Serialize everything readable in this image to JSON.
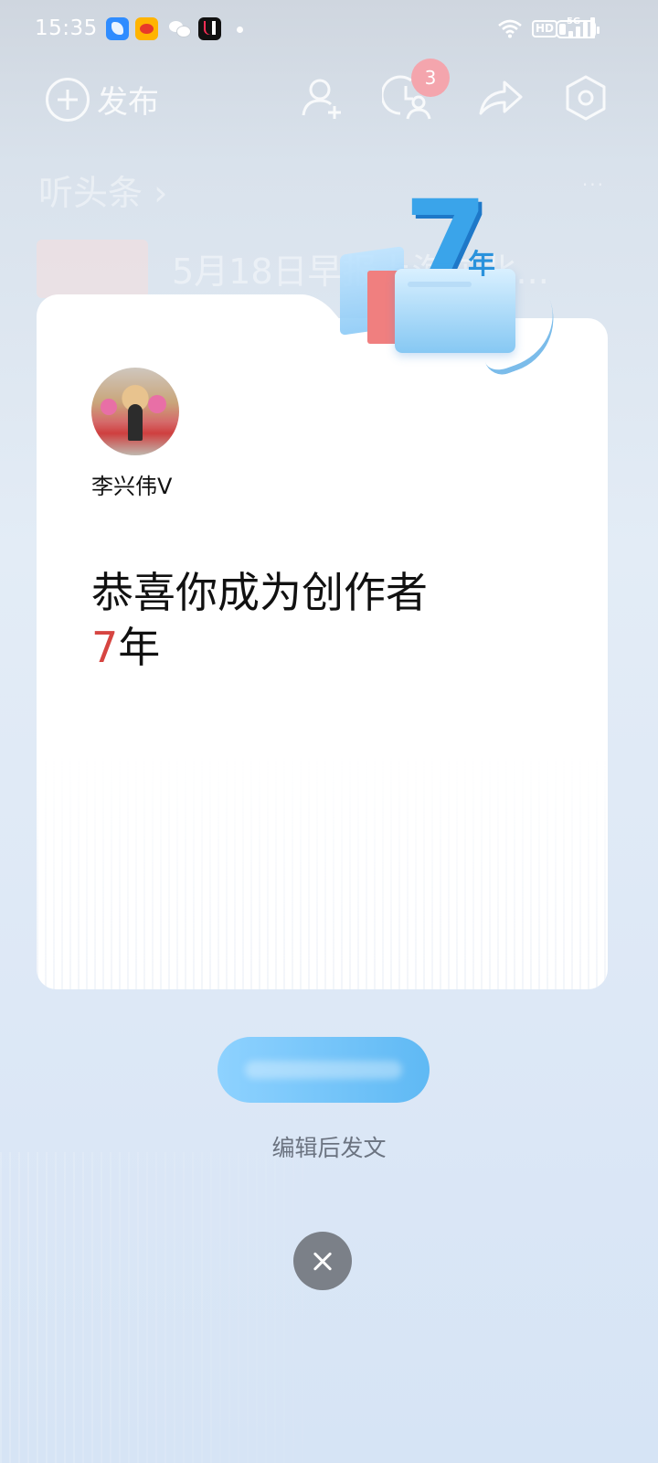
{
  "status_bar": {
    "time": "15:35",
    "network": "5G",
    "hd": "HD",
    "battery_level": 0.2
  },
  "header": {
    "publish_label": "发布",
    "notification_count": "3",
    "icons": [
      "add-friend-icon",
      "visitors-icon",
      "share-icon",
      "settings-icon"
    ]
  },
  "feed": {
    "section_title": "听头条 ›",
    "more": "···",
    "first_item_text": "5月18日早报上海车北..."
  },
  "card": {
    "username": "李兴伟V",
    "congrats_line": "恭喜你成为创作者",
    "years_number": "7",
    "years_unit": "年",
    "emblem_number": "7",
    "emblem_unit": "年"
  },
  "actions": {
    "edit_label": "编辑后发文"
  },
  "colors": {
    "accent_red": "#d64541",
    "accent_blue": "#5fb9f4"
  }
}
